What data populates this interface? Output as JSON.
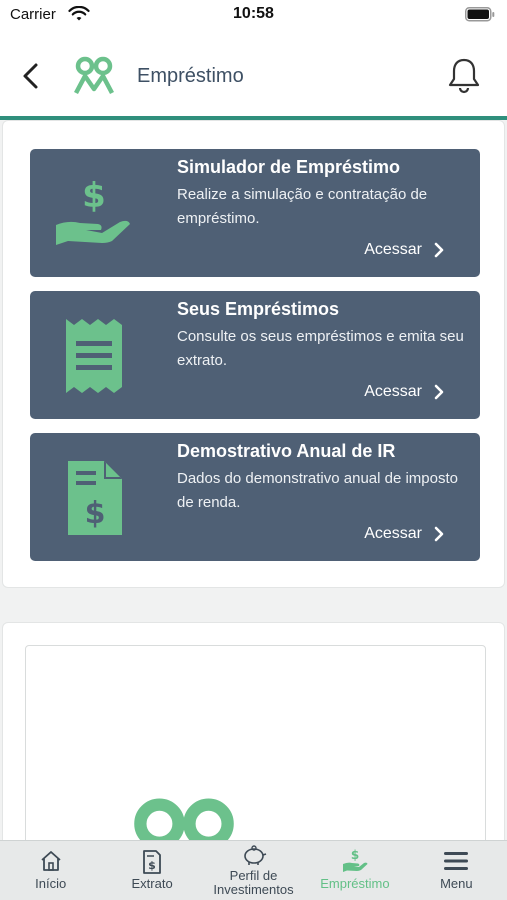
{
  "status_bar": {
    "carrier": "Carrier",
    "time": "10:58"
  },
  "header": {
    "title": "Empréstimo",
    "back_icon": "chevron-left-icon",
    "bell_icon": "bell-icon"
  },
  "colors": {
    "accent": "#6cc18c",
    "card_bg": "#4f6075",
    "header_line": "#2f8f7c"
  },
  "cards": [
    {
      "title": "Simulador de Empréstimo",
      "description": "Realize a simulação e contratação de empréstimo.",
      "action": "Acessar",
      "icon": "hand-dollar-icon"
    },
    {
      "title": "Seus Empréstimos",
      "description": "Consulte os seus empréstimos e emita seu extrato.",
      "action": "Acessar",
      "icon": "receipt-icon"
    },
    {
      "title": "Demostrativo Anual de IR",
      "description": "Dados do demonstrativo anual de imposto de renda.",
      "action": "Acessar",
      "icon": "document-dollar-icon"
    }
  ],
  "tabs": [
    {
      "label": "Início",
      "icon": "home-icon"
    },
    {
      "label": "Extrato",
      "icon": "statement-icon"
    },
    {
      "label": "Perfil de Investimentos",
      "icon": "piggy-bank-icon"
    },
    {
      "label": "Empréstimo",
      "icon": "hand-dollar-icon",
      "active": true
    },
    {
      "label": "Menu",
      "icon": "hamburger-icon"
    }
  ]
}
